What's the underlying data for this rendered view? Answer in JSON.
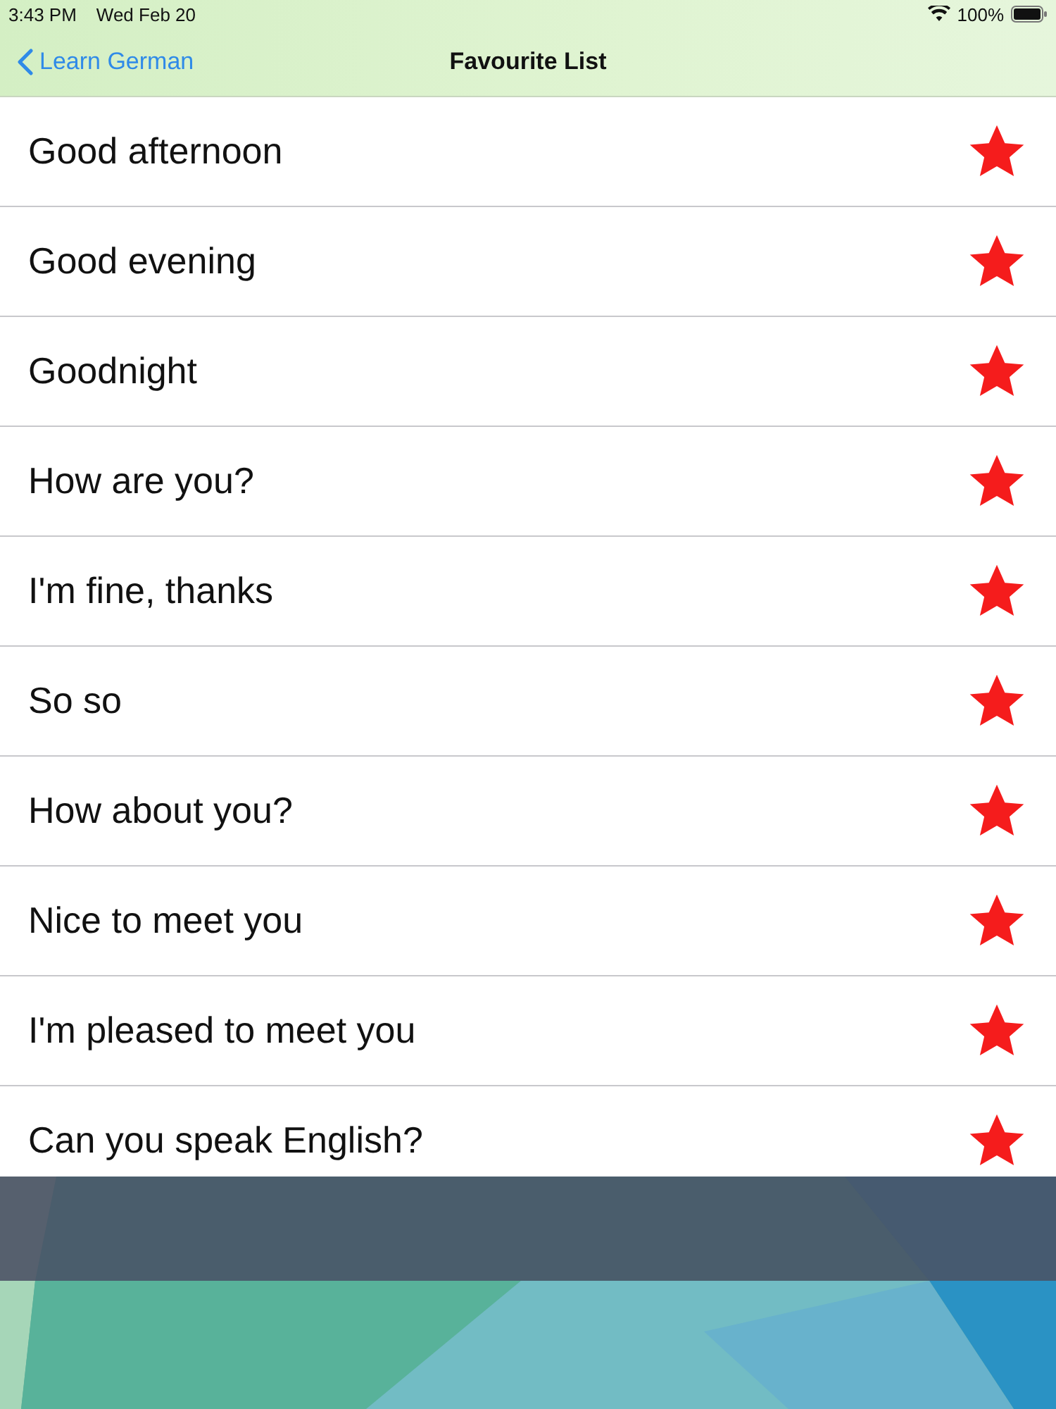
{
  "status_bar": {
    "time": "3:43 PM",
    "date": "Wed Feb 20",
    "battery": "100%"
  },
  "nav": {
    "back": "Learn German",
    "title": "Favourite List"
  },
  "items": [
    {
      "text": "Good afternoon",
      "favourite": true
    },
    {
      "text": "Good evening",
      "favourite": true
    },
    {
      "text": "Goodnight",
      "favourite": true
    },
    {
      "text": "How are you?",
      "favourite": true
    },
    {
      "text": "I'm fine, thanks",
      "favourite": true
    },
    {
      "text": "So so",
      "favourite": true
    },
    {
      "text": "How about you?",
      "favourite": true
    },
    {
      "text": "Nice to meet you",
      "favourite": true
    },
    {
      "text": "I'm pleased to meet you",
      "favourite": true
    },
    {
      "text": "Can you speak English?",
      "favourite": true
    }
  ]
}
